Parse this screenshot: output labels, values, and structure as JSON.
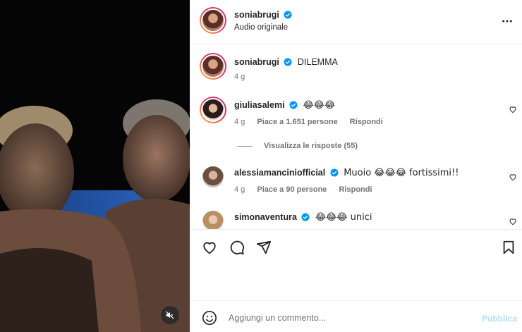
{
  "post": {
    "author": "soniabrugi",
    "audio": "Audio originale",
    "caption": "DILEMMA",
    "age": "4 g"
  },
  "comments": [
    {
      "username": "giuliasalemi",
      "text": "😂😂😂",
      "age": "4 g",
      "likes": "Piace a 1.651 persone",
      "reply": "Rispondi",
      "view_replies": "Visualizza le risposte (55)"
    },
    {
      "username": "alessiamanciniofficial",
      "text": "Muoio 😂😂😂 fortissimi!!",
      "age": "4 g",
      "likes": "Piace a 90 persone",
      "reply": "Rispondi"
    },
    {
      "username": "simonaventura",
      "text": "😂😂😂 unici"
    }
  ],
  "composer": {
    "placeholder": "Aggiungi un commento...",
    "publish": "Pubblica"
  },
  "icons": {
    "more": "more-icon",
    "verified": "verified-badge-icon",
    "like": "heart-icon",
    "comment": "comment-icon",
    "share": "share-icon",
    "save": "bookmark-icon",
    "emoji": "emoji-icon",
    "mute": "muted-speaker-icon"
  },
  "colors": {
    "verified": "#0095f6",
    "publish_disabled": "#b2dffc"
  }
}
